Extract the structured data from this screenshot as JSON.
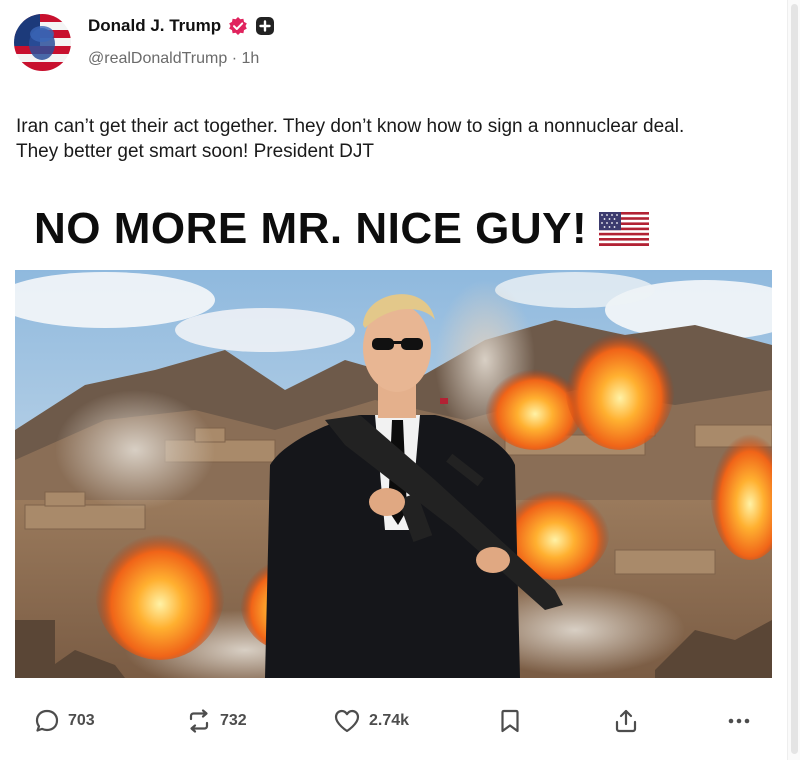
{
  "author": {
    "display_name": "Donald J. Trump",
    "handle": "@realDonaldTrump",
    "separator": "·",
    "time": "1h",
    "verified_icon": "verified-badge-icon",
    "extra_badge_icon": "plus-badge-icon"
  },
  "post": {
    "text": "Iran can’t get their act together. They don’t know how to sign a nonnuclear deal. They better get smart soon! President DJT",
    "headline": "NO MORE MR. NICE GUY!",
    "headline_emoji": "us-flag-icon"
  },
  "actions": {
    "reply_count": "703",
    "repost_count": "732",
    "like_count": "2.74k",
    "reply_icon": "reply-icon",
    "repost_icon": "repost-icon",
    "like_icon": "heart-icon",
    "bookmark_icon": "bookmark-icon",
    "share_icon": "share-icon",
    "more_icon": "more-icon"
  },
  "colors": {
    "verified": "#e0245e",
    "text": "#111111",
    "muted": "#6b6b6b",
    "fire": "#ff7a1a"
  }
}
